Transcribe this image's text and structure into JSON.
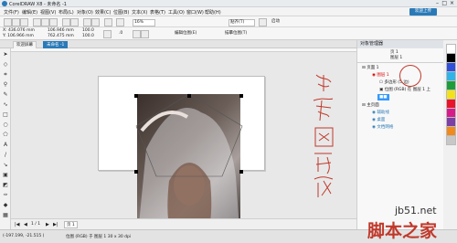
{
  "app": {
    "title": "CorelDRAW X8 - 未命名 -1"
  },
  "menu": [
    "文件(F)",
    "编辑(E)",
    "视图(V)",
    "布局(L)",
    "对象(O)",
    "效果(C)",
    "位图(B)",
    "文本(X)",
    "表格(T)",
    "工具(O)",
    "窗口(W)",
    "帮助(H)"
  ],
  "toolbar": {
    "zoom": "16%",
    "snap": "贴齐(T)",
    "launch": "启动",
    "upload": "欢迎上传"
  },
  "propbar": {
    "x": "X: 436.076 mm",
    "y": "Y: 106.966 mm",
    "w": "106.946 mm",
    "h": "762.475 mm",
    "sx": "100.0",
    "sy": "100.0",
    "rot": ".0",
    "mode": "编辑位图(E)",
    "trace": "描摹位图(T)"
  },
  "tabs": {
    "welcome": "欢迎屏幕",
    "doc": "未命名 -1"
  },
  "panel": {
    "title": "对象管理器",
    "page": "页 1",
    "subpage": "图层 1",
    "layers": [
      {
        "label": "页面 1",
        "indent": 0
      },
      {
        "label": "图层 1",
        "indent": 1
      },
      {
        "label": "多边形 (5 边)",
        "indent": 2
      },
      {
        "label": "位图 (RGB) 在 图层 1 上",
        "indent": 2
      },
      {
        "label": "主页面",
        "indent": 0
      },
      {
        "label": "辅助线",
        "indent": 1
      },
      {
        "label": "桌面",
        "indent": 1
      },
      {
        "label": "文档网格",
        "indent": 1
      }
    ]
  },
  "pagebar": {
    "nav": "1 / 1",
    "page": "页 1"
  },
  "status": {
    "coords": "(-197.199, -21.515 )",
    "object": "位图 (RGB) 于 图层 1 30 x 30 dpi"
  },
  "annotation": {
    "text": "注意图层顺序"
  },
  "watermark": {
    "site": "jb51.net",
    "brand": "脚本之家"
  },
  "colors": {
    "accent": "#2a7ab8",
    "annotation": "#c0392b",
    "highlight": "#3399ff"
  }
}
